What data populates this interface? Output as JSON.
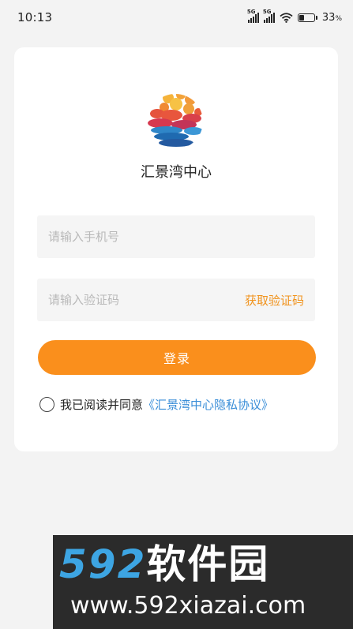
{
  "status_bar": {
    "time": "10:13",
    "network_1": "5G",
    "network_2": "5G",
    "battery_level": 0.33,
    "battery_text": "33",
    "battery_unit": "%"
  },
  "app": {
    "name": "汇景湾中心"
  },
  "form": {
    "phone_placeholder": "请输入手机号",
    "code_placeholder": "请输入验证码",
    "get_code_label": "获取验证码",
    "login_label": "登录",
    "agree_text": "我已阅读并同意",
    "agree_link": "《汇景湾中心隐私协议》"
  },
  "watermark": {
    "number": "592",
    "title": "软件园",
    "url": "www.592xiazai.com"
  },
  "colors": {
    "accent": "#fa8f1c",
    "link": "#3a8ed8",
    "background": "#f3f3f3"
  }
}
